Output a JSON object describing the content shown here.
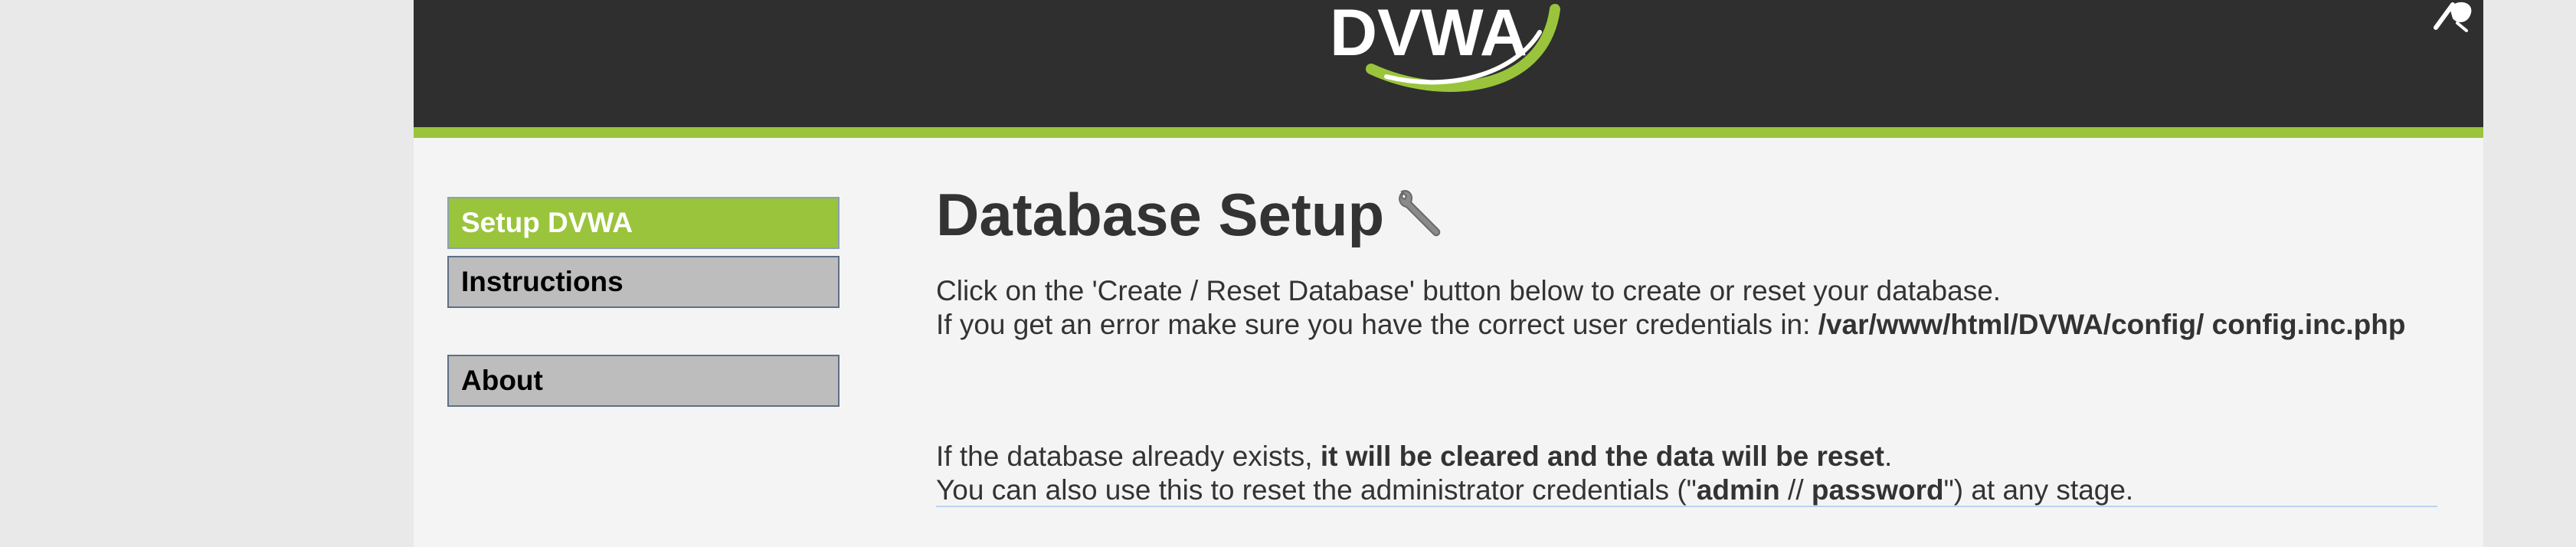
{
  "header": {
    "logo_text": "DVWA"
  },
  "menu": {
    "items": [
      {
        "label": "Setup DVWA",
        "selected": true
      },
      {
        "label": "Instructions",
        "selected": false
      },
      {
        "label": "About",
        "selected": false
      }
    ]
  },
  "main": {
    "title": "Database Setup",
    "title_icon": "wrench-icon",
    "para1": {
      "line1": "Click on the 'Create / Reset Database' button below to create or reset your database.",
      "line2_prefix": "If you get an error make sure you have the correct user credentials in: ",
      "config_path": "/var/www/html/DVWA/config/ config.inc.php"
    },
    "para2": {
      "prefix": "If the database already exists, ",
      "bold": "it will be cleared and the data will be reset",
      "suffix": ".",
      "line2_prefix": "You can also use this to reset the administrator credentials (\"",
      "admin": "admin",
      "separator": " // ",
      "password": "password",
      "line2_suffix": "\") at any stage."
    }
  },
  "colors": {
    "header_bg": "#2f2f2f",
    "accent_green": "#9ac43c",
    "menu_bg": "#bdbdbd",
    "page_bg": "#f4f4f4",
    "text": "#333333"
  }
}
